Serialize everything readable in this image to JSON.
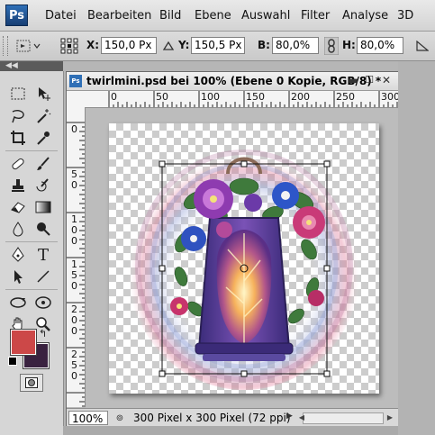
{
  "menubar": {
    "logo": "Ps",
    "items": [
      "Datei",
      "Bearbeiten",
      "Bild",
      "Ebene",
      "Auswahl",
      "Filter",
      "Analyse",
      "3D"
    ]
  },
  "options": {
    "x_label": "X:",
    "x_value": "150,0 Px",
    "y_label": "Y:",
    "y_value": "150,5 Px",
    "b_label": "B:",
    "b_value": "80,0%",
    "h_label": "H:",
    "h_value": "80,0%"
  },
  "document": {
    "icon": "Ps",
    "title": "twirlmini.psd bei 100% (Ebene 0 Kopie, RGB/8) *",
    "ruler_h_labels": [
      "0",
      "50",
      "100",
      "150",
      "200",
      "250",
      "300"
    ],
    "ruler_v_labels": [
      "0",
      "50",
      "100",
      "150",
      "200",
      "250"
    ],
    "zoom": "100%",
    "info": "300 Pixel x 300 Pixel (72 ppi)"
  },
  "colors": {
    "foreground": "#cc4848",
    "background": "#3a2240",
    "accent": "#2f6fb6"
  },
  "icons": [
    "marquee-icon",
    "move-icon",
    "lasso-icon",
    "magic-wand-icon",
    "crop-icon",
    "eyedropper-icon",
    "healing-brush-icon",
    "brush-icon",
    "clone-stamp-icon",
    "history-brush-icon",
    "eraser-icon",
    "gradient-icon",
    "blur-icon",
    "dodge-icon",
    "pen-icon",
    "type-icon",
    "path-selection-icon",
    "line-icon",
    "3d-rotate-icon",
    "3d-orbit-icon",
    "hand-icon",
    "zoom-icon",
    "quick-mask-icon"
  ]
}
